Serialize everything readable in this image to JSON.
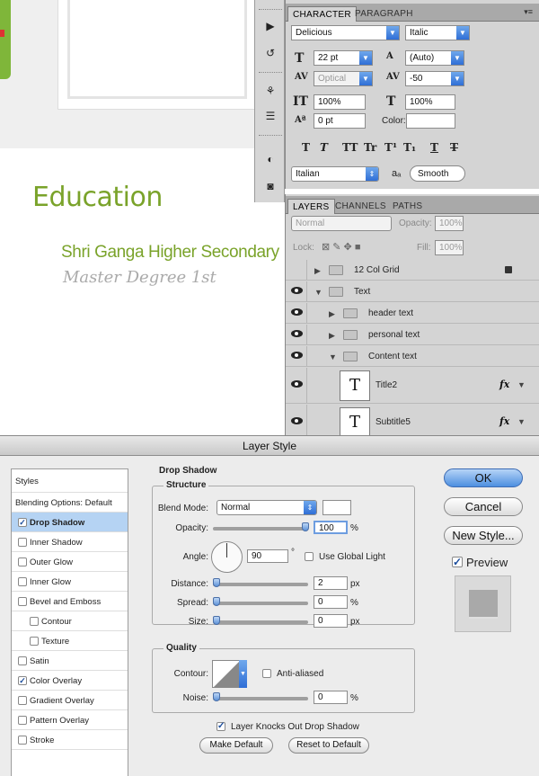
{
  "document": {
    "title": "Education",
    "school": "Shri Ganga Higher Secondary",
    "degree": "Master Degree 1st"
  },
  "character_panel": {
    "tabs": [
      "CHARACTER",
      "PARAGRAPH"
    ],
    "font_family": "Delicious",
    "font_style": "Italic",
    "font_size": "22 pt",
    "leading": "(Auto)",
    "kerning": "Optical",
    "tracking": "-50",
    "vertical_scale": "100%",
    "horizontal_scale": "100%",
    "baseline_shift": "0 pt",
    "color_label": "Color:",
    "language": "Italian",
    "antialias_label": "aₐ",
    "antialias": "Smooth",
    "type_styles": [
      "T",
      "T",
      "TT",
      "Tr",
      "T¹",
      "T₁",
      "T",
      "T"
    ]
  },
  "layers_panel": {
    "tabs": [
      "LAYERS",
      "CHANNELS",
      "PATHS"
    ],
    "blend_mode": "Normal",
    "opacity_label": "Opacity:",
    "opacity": "100%",
    "lock_label": "Lock:",
    "fill_label": "Fill:",
    "fill": "100%",
    "layers": [
      {
        "name": "12 Col Grid",
        "type": "group",
        "visible": false,
        "expanded": false,
        "locked": true
      },
      {
        "name": "Text",
        "type": "group",
        "visible": true,
        "expanded": true
      },
      {
        "name": "header text",
        "type": "group",
        "visible": true,
        "expanded": false
      },
      {
        "name": "personal text",
        "type": "group",
        "visible": true,
        "expanded": false
      },
      {
        "name": "Content text",
        "type": "group",
        "visible": true,
        "expanded": true
      },
      {
        "name": "Title2",
        "type": "text",
        "visible": true,
        "fx": "fx"
      },
      {
        "name": "Subtitle5",
        "type": "text",
        "visible": true,
        "fx": "fx"
      }
    ]
  },
  "dialog": {
    "title": "Layer Style",
    "styles_header": "Styles",
    "blending_options": "Blending Options: Default",
    "styles": [
      {
        "label": "Drop Shadow",
        "checked": true,
        "selected": true,
        "indent": false
      },
      {
        "label": "Inner Shadow",
        "checked": false,
        "indent": false
      },
      {
        "label": "Outer Glow",
        "checked": false,
        "indent": false
      },
      {
        "label": "Inner Glow",
        "checked": false,
        "indent": false
      },
      {
        "label": "Bevel and Emboss",
        "checked": false,
        "indent": false
      },
      {
        "label": "Contour",
        "checked": false,
        "indent": true
      },
      {
        "label": "Texture",
        "checked": false,
        "indent": true
      },
      {
        "label": "Satin",
        "checked": false,
        "indent": false
      },
      {
        "label": "Color Overlay",
        "checked": true,
        "indent": false
      },
      {
        "label": "Gradient Overlay",
        "checked": false,
        "indent": false
      },
      {
        "label": "Pattern Overlay",
        "checked": false,
        "indent": false
      },
      {
        "label": "Stroke",
        "checked": false,
        "indent": false
      }
    ],
    "section_title": "Drop Shadow",
    "structure": {
      "title": "Structure",
      "blend_mode_label": "Blend Mode:",
      "blend_mode": "Normal",
      "opacity_label": "Opacity:",
      "opacity": "100",
      "opacity_unit": "%",
      "angle_label": "Angle:",
      "angle": "90",
      "angle_unit": "°",
      "use_global_light": "Use Global Light",
      "distance_label": "Distance:",
      "distance": "2",
      "distance_unit": "px",
      "spread_label": "Spread:",
      "spread": "0",
      "spread_unit": "%",
      "size_label": "Size:",
      "size": "0",
      "size_unit": "px"
    },
    "quality": {
      "title": "Quality",
      "contour_label": "Contour:",
      "anti_aliased": "Anti-aliased",
      "noise_label": "Noise:",
      "noise": "0",
      "noise_unit": "%"
    },
    "layer_knocks_out": "Layer Knocks Out Drop Shadow",
    "make_default": "Make Default",
    "reset_default": "Reset to Default",
    "ok": "OK",
    "cancel": "Cancel",
    "new_style": "New Style...",
    "preview": "Preview"
  },
  "colors": {
    "accent_green": "#7aa32a",
    "selection_blue": "#b5d3f3",
    "button_blue": "#4d8fe0"
  }
}
